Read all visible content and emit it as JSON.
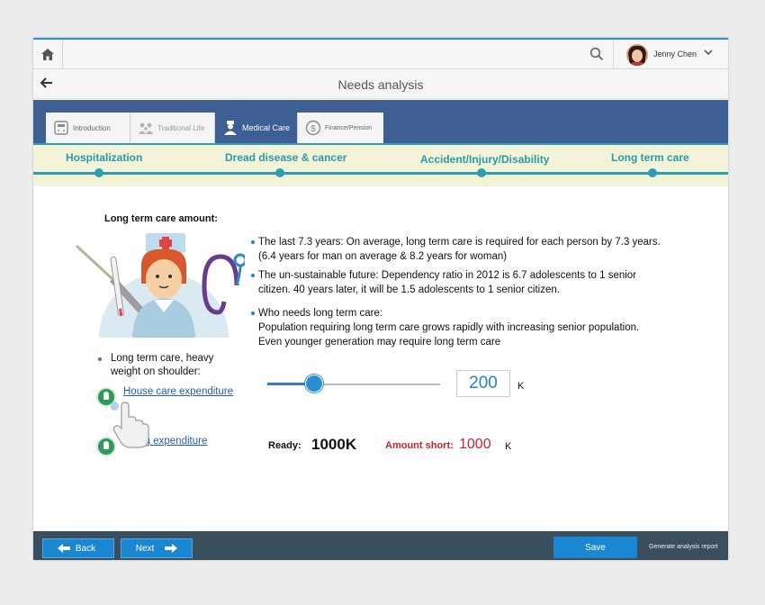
{
  "header": {
    "user_name": "Jenny Chen",
    "page_title": "Needs analysis",
    "icons": {
      "home": "home-icon",
      "search": "search-icon",
      "user_menu": "chevron-down-icon",
      "back": "back-arrow-icon"
    }
  },
  "tabs": [
    {
      "label": "Introduction",
      "icon": "calculator-icon",
      "active": false
    },
    {
      "label": "Traditional Life",
      "icon": "family-icon",
      "active": false
    },
    {
      "label": "Medical Care",
      "icon": "doctor-icon",
      "active": true
    },
    {
      "label": "Finance/Pension",
      "icon": "dollar-icon",
      "active": false
    }
  ],
  "subnav": [
    {
      "label": "Hospitalization"
    },
    {
      "label": "Dread disease & cancer"
    },
    {
      "label": "Accident/Injury/Disability"
    },
    {
      "label": "Long term care",
      "active": true
    }
  ],
  "content": {
    "amount_title": "Long term care amount:",
    "bullets": [
      {
        "lines": [
          "The last 7.3 years: On average, long term care is required for each person by 7.3 years.",
          "(6.4 years for man on average & 8.2 years for woman)"
        ]
      },
      {
        "lines": [
          "The un-sustainable future: Dependency ratio in 2012 is 6.7 adolescents to 1 senior",
          "citizen. 40 years later, it will be 1.5 adolescents to 1 senior citizen."
        ]
      },
      {
        "lines": [
          "Who needs long term care:",
          "Population requiring long term care grows rapidly with increasing senior population.",
          "Even younger generation may require long term care"
        ]
      }
    ],
    "left_bullet": "Long term care, heavy weight on shoulder:",
    "links": {
      "house": "House care expenditure",
      "living": "Living expenditure"
    },
    "slider": {
      "fraction": 0.27,
      "value": "200",
      "unit": "K"
    },
    "ready_label": "Ready:",
    "ready_value": "1000K",
    "short_label": "Amount short:",
    "short_value": "1000",
    "short_unit": "K"
  },
  "footer": {
    "back_label": "Back",
    "next_label": "Next",
    "save_label": "Save",
    "generate_label": "Generate analysis report"
  },
  "colors": {
    "accent": "#1b86d2",
    "tab_band": "#3e5f93",
    "subnav_text": "#2b9aa8",
    "short": "#c0272d"
  }
}
